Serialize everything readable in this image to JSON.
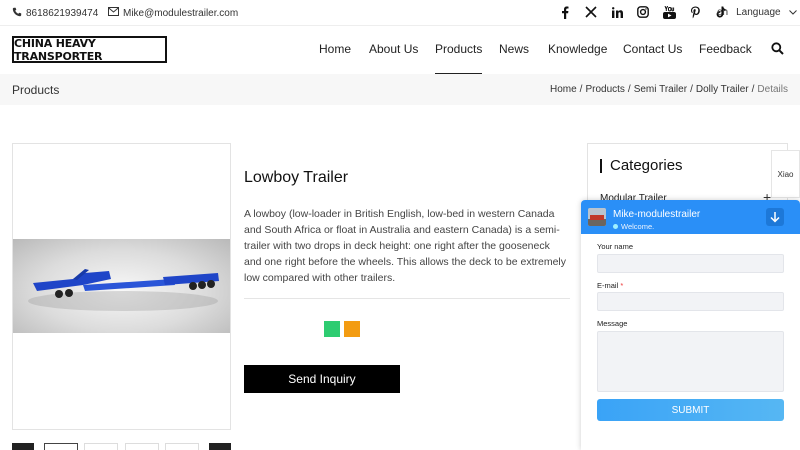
{
  "topbar": {
    "phone": "8618621939474",
    "email": "Mike@modulestrailer.com",
    "socials": [
      "facebook-icon",
      "x-icon",
      "linkedin-icon",
      "instagram-icon",
      "youtube-icon",
      "pinterest-icon",
      "tiktok-icon"
    ],
    "lang_code": "en",
    "lang_label": "Language"
  },
  "header": {
    "logo_text": "CHINA HEAVY TRANSPORTER",
    "nav": [
      "Home",
      "About Us",
      "Products",
      "News",
      "Knowledge",
      "Contact Us",
      "Feedback"
    ],
    "active_nav": "Products"
  },
  "breadcrumb": {
    "page_title": "Products",
    "items": [
      "Home",
      "Products",
      "Semi Trailer",
      "Dolly Trailer",
      "Details"
    ]
  },
  "product": {
    "title": "Lowboy Trailer",
    "description": "A lowboy (low-loader in British English, low-bed in western Canada and South Africa or float in Australia and eastern Canada) is a semi-trailer with two drops in deck height: one right after the gooseneck and one right before the wheels. This allows the deck to be extremely low compared with other trailers.",
    "share_colors": [
      "#2ecc71",
      "#f39c12"
    ],
    "inquiry_label": "Send Inquiry",
    "trailer_color": "#1f45c8"
  },
  "categories": {
    "heading": "Categories",
    "first_item": "Modular Trailer",
    "expand_symbol": "+"
  },
  "side_tab": {
    "label": "Xiao"
  },
  "chat": {
    "name": "Mike-modulestrailer",
    "status": "Welcome.",
    "fields": {
      "name_label": "Your name",
      "email_label": "E-mail",
      "email_required": "*",
      "message_label": "Message"
    },
    "submit_label": "SUBMIT",
    "header_color": "#2a8ff7"
  }
}
